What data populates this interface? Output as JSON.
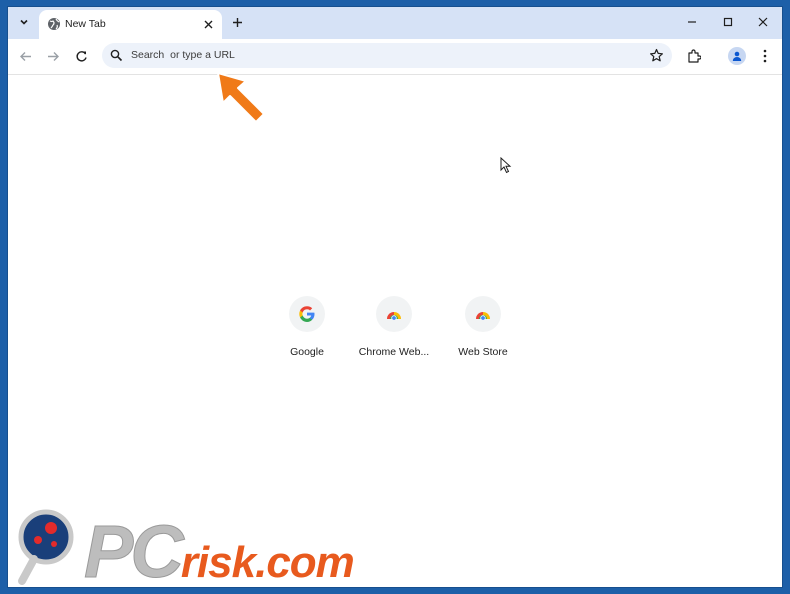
{
  "tabstrip": {
    "tab_title": "New Tab"
  },
  "toolbar": {
    "omnibox_placeholder": "Search  or type a URL"
  },
  "shortcuts": [
    {
      "label": "Google",
      "icon": "google-g-icon"
    },
    {
      "label": "Chrome Web...",
      "icon": "chrome-web-store-icon"
    },
    {
      "label": "Web Store",
      "icon": "chrome-web-store-icon"
    }
  ],
  "watermark": {
    "brand_pc": "PC",
    "brand_rest": "risk.com"
  },
  "colors": {
    "tabstrip_bg": "#d6e2f6",
    "omnibox_bg": "#edf2fa",
    "accent_blue": "#1a73e8",
    "arrow_orange": "#f07a18",
    "desktop_blue": "#1d5fa8"
  }
}
